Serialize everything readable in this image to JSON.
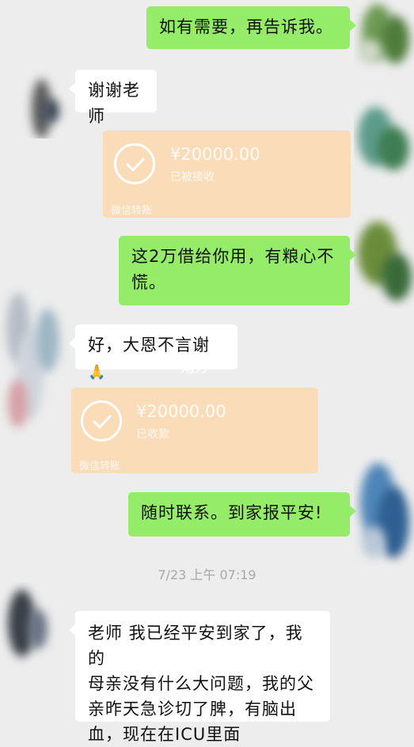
{
  "messages": {
    "m1": "如有需要，再告诉我。",
    "m2": "谢谢老师",
    "m3_line1": "这2万借给你用，有粮心不",
    "m3_line2": "慌。",
    "m4": "好，大恩不言谢",
    "m4_emoji": "🙏",
    "m5": "随时联系。到家报平安!",
    "m6_line1": "老师 我已经平安到家了，我的",
    "m6_line2": "母亲没有什么大问题，我的父",
    "m6_line3": "亲昨天急诊切了脾，有脑出",
    "m6_line4": "血，现在在ICU里面"
  },
  "transfers": {
    "t1": {
      "amount": "¥20000.00",
      "status": "已被接收",
      "footer": "微信转账"
    },
    "t2": {
      "amount": "¥20000.00",
      "status": "已收款",
      "footer": "微信转账"
    }
  },
  "timestamp": "7/23 上午 07:19",
  "watermark": "南方"
}
